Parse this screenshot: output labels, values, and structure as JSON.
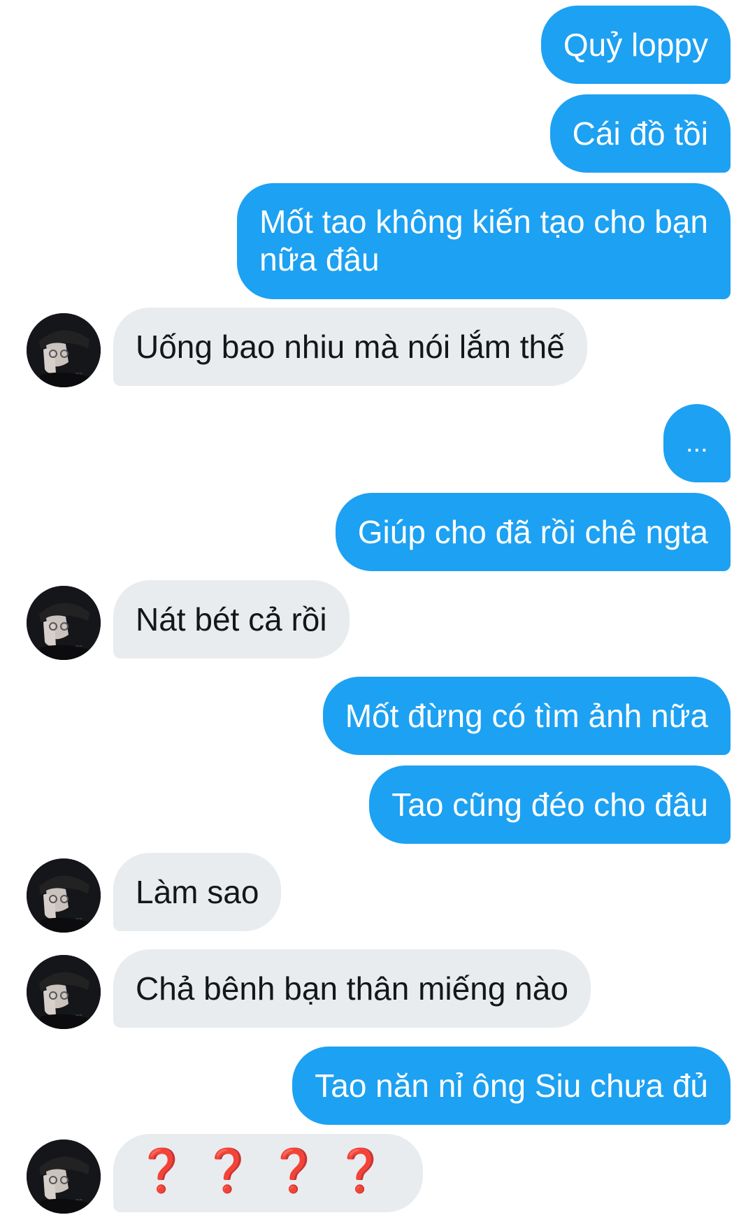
{
  "conversation": {
    "messages": [
      {
        "side": "sent",
        "text": "Quỷ loppy"
      },
      {
        "side": "sent",
        "text": "Cái đồ tồi"
      },
      {
        "side": "sent",
        "lines": [
          "Mốt tao không kiến tạo cho bạn",
          "nữa đâu"
        ]
      },
      {
        "side": "received",
        "text": "Uống bao nhiu mà nói lắm thế"
      },
      {
        "side": "sent",
        "text": "..."
      },
      {
        "side": "sent",
        "text": "Giúp cho đã rồi chê ngta"
      },
      {
        "side": "received",
        "text": "Nát bét cả rồi"
      },
      {
        "side": "sent",
        "text": "Mốt đừng có tìm ảnh nữa"
      },
      {
        "side": "sent",
        "text": "Tao cũng đéo cho đâu"
      },
      {
        "side": "received",
        "text": "Làm sao"
      },
      {
        "side": "received",
        "text": "Chả bênh bạn thân miếng nào"
      },
      {
        "side": "sent",
        "text": "Tao năn nỉ ông Siu chưa đủ"
      },
      {
        "side": "received",
        "text": "❓❓❓❓",
        "emoji": "red-question-mark x4"
      }
    ]
  },
  "colors": {
    "sent_bubble": "#1da1f2",
    "received_bubble": "#e8ecef",
    "sent_text": "#ffffff",
    "received_text": "#14171a",
    "emoji_red": "#e0202a"
  },
  "icons": {
    "avatar": "contact-avatar-photo"
  }
}
